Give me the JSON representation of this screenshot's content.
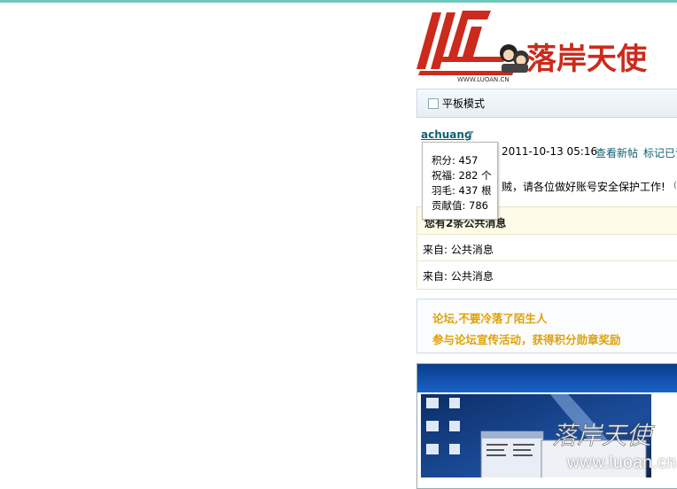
{
  "logo": {
    "brand_text": "落岸天使",
    "domain_text": "WWW.LUOAN.CN",
    "colors": {
      "red": "#cc2a1c"
    }
  },
  "tablet": {
    "label": "平板模式"
  },
  "user": {
    "name": "achuang",
    "datetime": "2011-10-13 05:16",
    "view_new": "查看新帖",
    "mark_read": "标记已读"
  },
  "notice": {
    "text": "贼，请各位做好账号安全保护工作!",
    "paren": "("
  },
  "popup": {
    "points": "积分: 457",
    "blessing": "祝福: 282 个",
    "feathers": "羽毛: 437 根",
    "contribution": "贡献值: 786"
  },
  "messages": {
    "header": "您有2条公共消息",
    "rows": [
      "来自: 公共消息",
      "来自: 公共消息"
    ]
  },
  "promo": {
    "line1": "论坛,不要冷落了陌生人",
    "line2": "参与论坛宣传活动，获得积分勋章奖励",
    "color": "#e0a10a"
  },
  "screenshot": {
    "watermark_cn": "落岸天使",
    "watermark_url": "www.luoan.cn"
  }
}
